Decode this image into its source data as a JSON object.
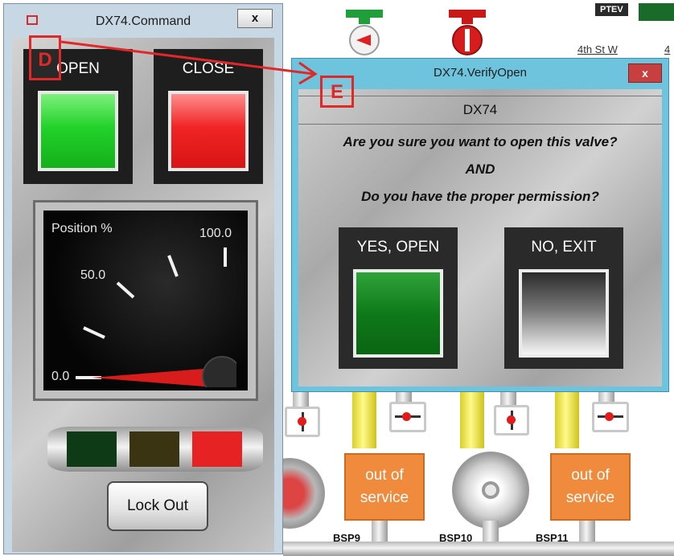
{
  "background": {
    "street_label": "4th St W",
    "street_label_cut": "4",
    "top_indicator": "PTEV",
    "out_of_service_1": [
      "out of",
      "service"
    ],
    "out_of_service_2": [
      "out of",
      "service"
    ],
    "bsp_labels": [
      "BSP9",
      "BSP10",
      "BSP11"
    ]
  },
  "command_window": {
    "title": "DX74.Command",
    "close_label": "x",
    "open_label": "OPEN",
    "close_cmd_label": "CLOSE",
    "gauge": {
      "title": "Position %",
      "tick_labels": [
        "0.0",
        "50.0",
        "100.0"
      ],
      "value_percent": 0
    },
    "status_segments": [
      "#0f3a16",
      "#3a3412",
      "#e62222"
    ],
    "lockout_label": "Lock Out"
  },
  "verify_window": {
    "title": "DX74.VerifyOpen",
    "close_label": "x",
    "header": "DX74",
    "question_line1": "Are you sure you want to open this valve?",
    "question_line2": "AND",
    "question_line3": "Do you have the proper permission?",
    "yes_label": "YES, OPEN",
    "no_label": "NO, EXIT"
  },
  "annotations": {
    "marker_d": "D",
    "marker_e": "E",
    "color": "#e12828"
  }
}
